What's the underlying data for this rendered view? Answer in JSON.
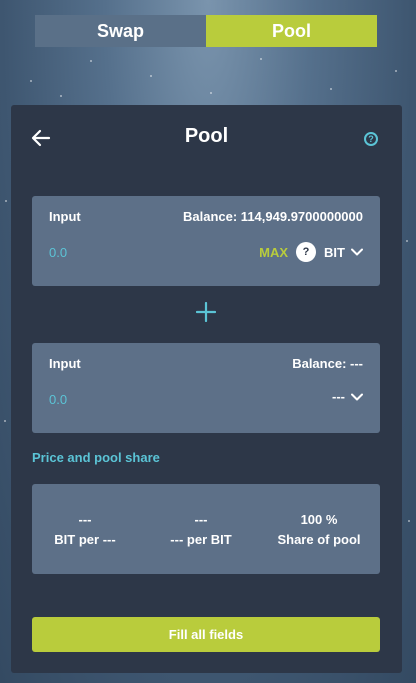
{
  "tabs": [
    {
      "label": "Swap",
      "active": false
    },
    {
      "label": "Pool",
      "active": true
    }
  ],
  "card": {
    "title": "Pool",
    "back_icon": "arrow-left-icon",
    "help_icon": "help-circle-icon",
    "help_glyph": "?"
  },
  "input_a": {
    "label": "Input",
    "balance": "Balance: 114,949.9700000000",
    "placeholder": "0.0",
    "max_label": "MAX",
    "token_icon_glyph": "?",
    "token": "BIT"
  },
  "plus_icon": "plus-icon",
  "input_b": {
    "label": "Input",
    "balance": "Balance: ---",
    "placeholder": "0.0",
    "token": "---"
  },
  "price_section": {
    "label": "Price and pool share",
    "items": [
      {
        "value": "---",
        "label": "BIT per ---"
      },
      {
        "value": "---",
        "label": "--- per BIT"
      },
      {
        "value": "100 %",
        "label": "Share of pool"
      }
    ]
  },
  "submit": {
    "label": "Fill all fields"
  },
  "colors": {
    "accent": "#b9cc3c",
    "cyan": "#5bc4d6",
    "card_bg": "#2d3748",
    "panel_bg": "#5d7088"
  }
}
